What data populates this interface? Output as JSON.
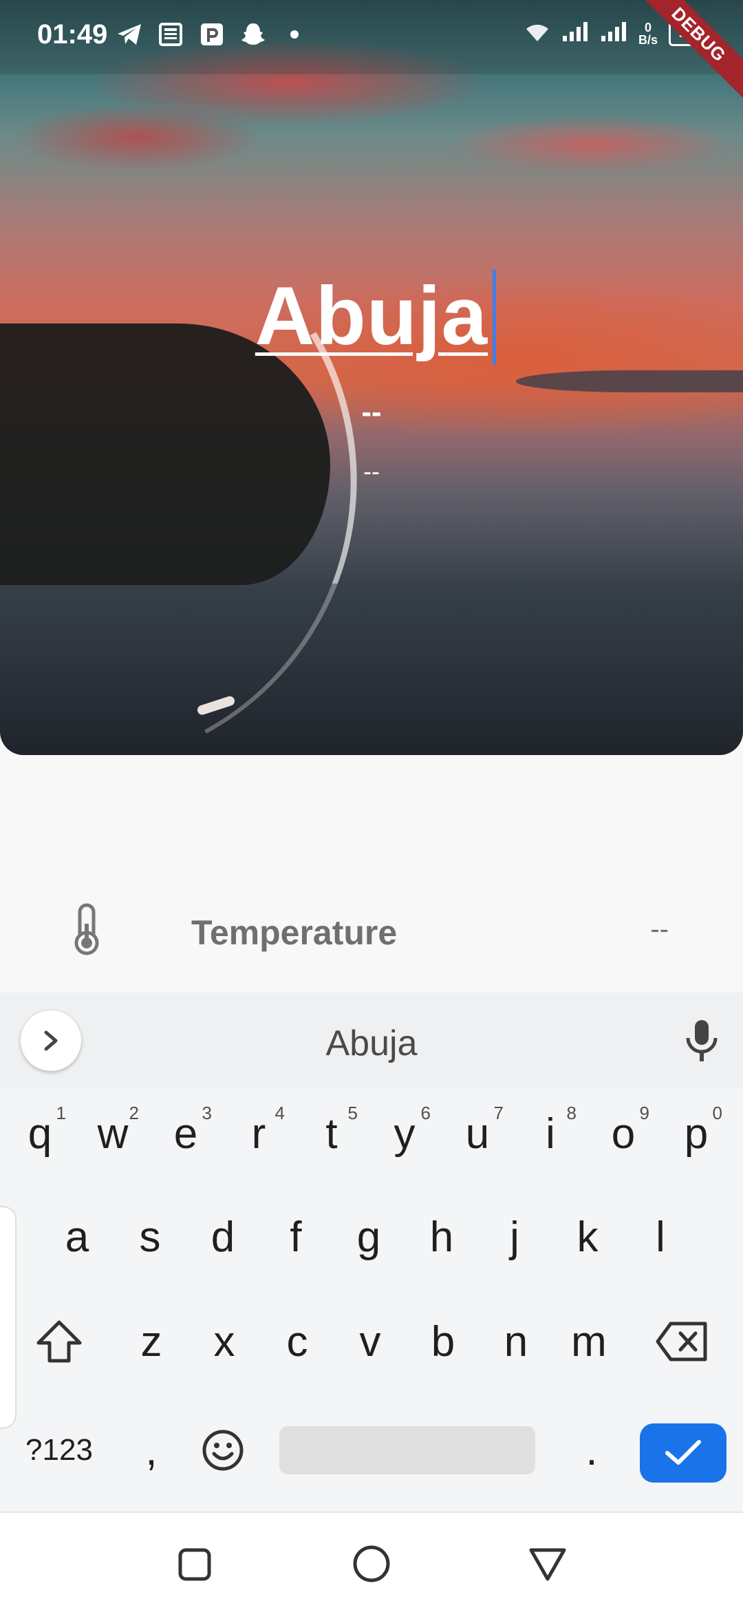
{
  "status_bar": {
    "time": "01:49",
    "net_speed_value": "0",
    "net_speed_unit": "B/s",
    "battery": "93",
    "debug_label": "DEBUG"
  },
  "hero": {
    "city": "Abuja",
    "value_primary": "--",
    "value_secondary": "--"
  },
  "details": {
    "temperature_label": "Temperature",
    "temperature_value": "--"
  },
  "keyboard": {
    "suggestion": "Abuja",
    "row1": [
      {
        "c": "q",
        "h": "1"
      },
      {
        "c": "w",
        "h": "2"
      },
      {
        "c": "e",
        "h": "3"
      },
      {
        "c": "r",
        "h": "4"
      },
      {
        "c": "t",
        "h": "5"
      },
      {
        "c": "y",
        "h": "6"
      },
      {
        "c": "u",
        "h": "7"
      },
      {
        "c": "i",
        "h": "8"
      },
      {
        "c": "o",
        "h": "9"
      },
      {
        "c": "p",
        "h": "0"
      }
    ],
    "row2": [
      "a",
      "s",
      "d",
      "f",
      "g",
      "h",
      "j",
      "k",
      "l"
    ],
    "row3": [
      "z",
      "x",
      "c",
      "v",
      "b",
      "n",
      "m"
    ],
    "symbols_label": "?123",
    "comma": ",",
    "period": "."
  },
  "colors": {
    "accent": "#1a73e8",
    "caret": "#3d7ff0",
    "debug_ribbon": "#a3242a"
  }
}
